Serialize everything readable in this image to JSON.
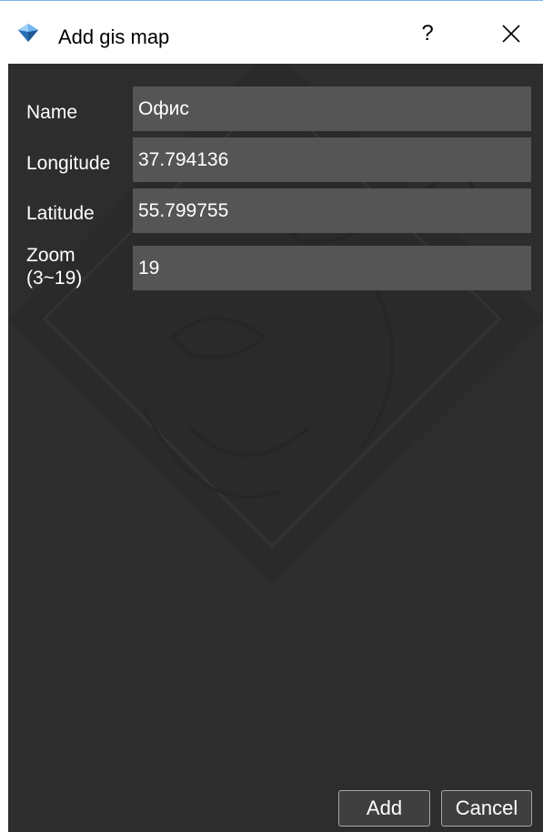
{
  "window": {
    "title": "Add gis map",
    "help_label": "?",
    "title_icon": "app-gem-icon",
    "close_icon": "close-icon"
  },
  "form": {
    "name": {
      "label": "Name",
      "value": "Офис"
    },
    "longitude": {
      "label": "Longitude",
      "value": "37.794136"
    },
    "latitude": {
      "label": "Latitude",
      "value": "55.799755"
    },
    "zoom": {
      "label_line1": "Zoom",
      "label_line2": "(3~19)",
      "value": "19"
    }
  },
  "buttons": {
    "add": "Add",
    "cancel": "Cancel"
  },
  "colors": {
    "panel_bg": "#2d2d2d",
    "field_bg": "#555555",
    "text": "#ffffff",
    "title_border": "#7eb4ea"
  }
}
